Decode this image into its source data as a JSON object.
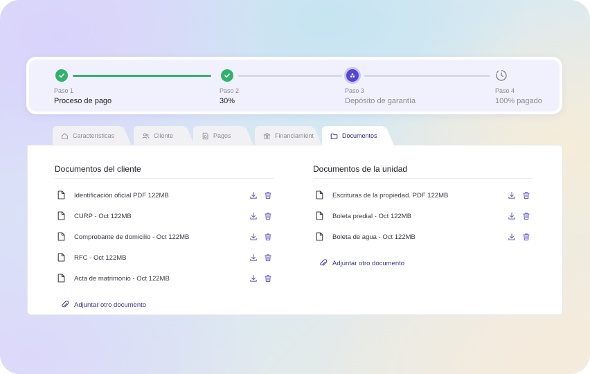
{
  "stepper": {
    "steps": [
      {
        "caption": "Paso 1",
        "name": "Proceso de pago",
        "state": "done"
      },
      {
        "caption": "Paso 2",
        "name": "30%",
        "state": "done"
      },
      {
        "caption": "Paso 3",
        "name": "Depósito de garantía",
        "state": "active"
      },
      {
        "caption": "Paso 4",
        "name": "100% pagado",
        "state": "pending"
      }
    ],
    "segments_completed": [
      1,
      0,
      0
    ],
    "colors": {
      "done": "#2fb36b",
      "active": "#5346d6",
      "pending": "#d9d8e6"
    }
  },
  "tabs": [
    {
      "label": "Características",
      "icon": "home-icon"
    },
    {
      "label": "Cliente",
      "icon": "users-icon"
    },
    {
      "label": "Pagos",
      "icon": "receipt-icon"
    },
    {
      "label": "Financiamiento",
      "icon": "bank-icon"
    },
    {
      "label": "Documentos",
      "icon": "folder-icon",
      "active": true
    }
  ],
  "client_docs": {
    "title": "Documentos del cliente",
    "items": [
      "Identificación oficial PDF 122MB",
      "CURP - Oct 122MB",
      "Comprobante de domicilio - Oct 122MB",
      "RFC - Oct 122MB",
      "Acta de matrimonio - Oct 122MB"
    ],
    "attach_label": "Adjuntar otro documento"
  },
  "unit_docs": {
    "title": "Documentos de la unidad",
    "items": [
      "Escrituras de la propiedad. PDF 122MB",
      "Boleta predial - Oct 122MB",
      "Boleta de agua - Oct 122MB"
    ],
    "attach_label": "Adjuntar otro documento"
  },
  "icons": {
    "row_actions": [
      "download-icon",
      "trash-icon"
    ],
    "file": "file-icon",
    "attach": "paperclip-icon"
  },
  "accent": "#5346d6"
}
